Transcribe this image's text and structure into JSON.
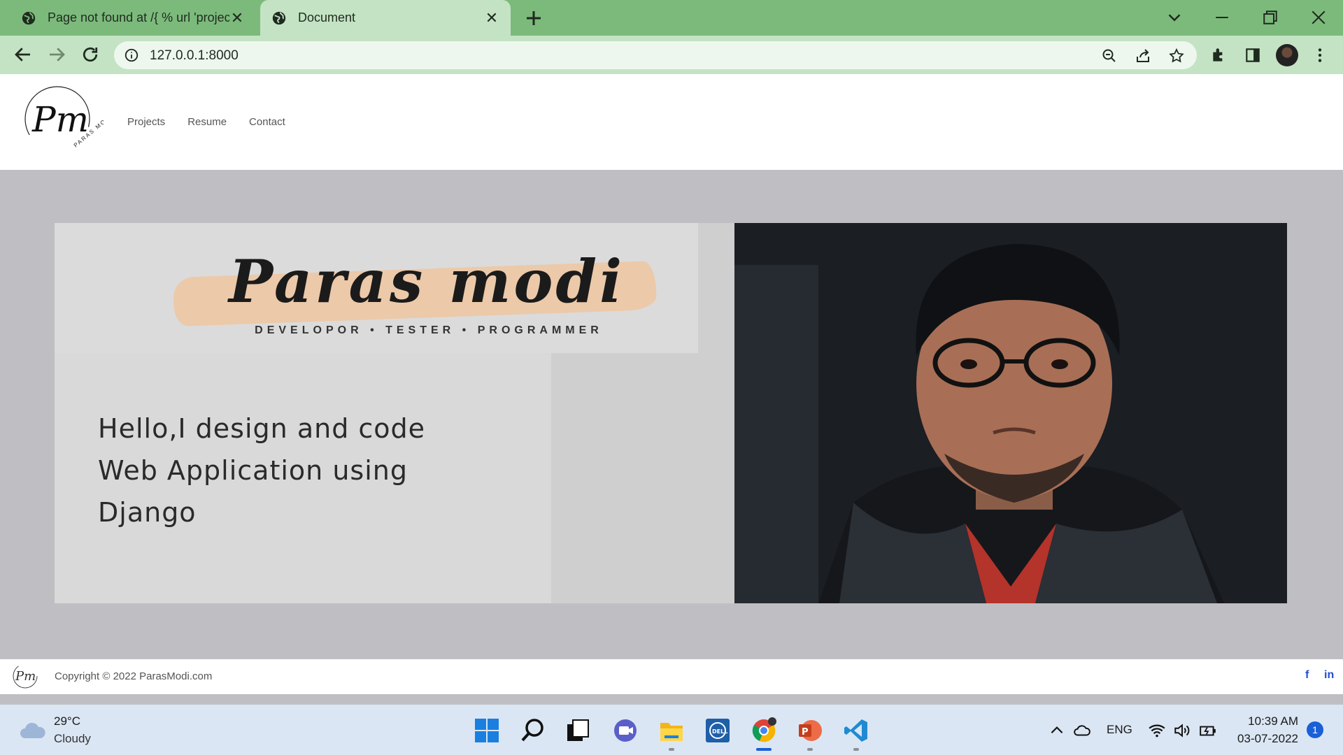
{
  "browser": {
    "tabs": [
      {
        "title": "Page not found at /{ % url 'projec",
        "active": false
      },
      {
        "title": "Document",
        "active": true
      }
    ],
    "address": "127.0.0.1:8000"
  },
  "site": {
    "nav": [
      "Projects",
      "Resume",
      "Contact"
    ],
    "logo_text": "Pm",
    "logo_sub": "PARAS MODI",
    "hero": {
      "name": "Paras modi",
      "subtitle": "DEVELOPOR • TESTER • PROGRAMMER",
      "tagline_lines": [
        "Hello,I design and code",
        "Web Application using",
        "Django"
      ]
    },
    "footer": {
      "copyright": "Copyright © 2022 ParasModi.com",
      "social": [
        "f",
        "in"
      ]
    }
  },
  "taskbar": {
    "weather": {
      "temp": "29°C",
      "condition": "Cloudy"
    },
    "language": "ENG",
    "time": "10:39 AM",
    "date": "03-07-2022",
    "notifications": "1"
  },
  "colors": {
    "tabstrip": "#7cba7c",
    "toolbar": "#c4e3c4",
    "page_bg": "#bfbfc3",
    "link": "#1f4fd1"
  }
}
